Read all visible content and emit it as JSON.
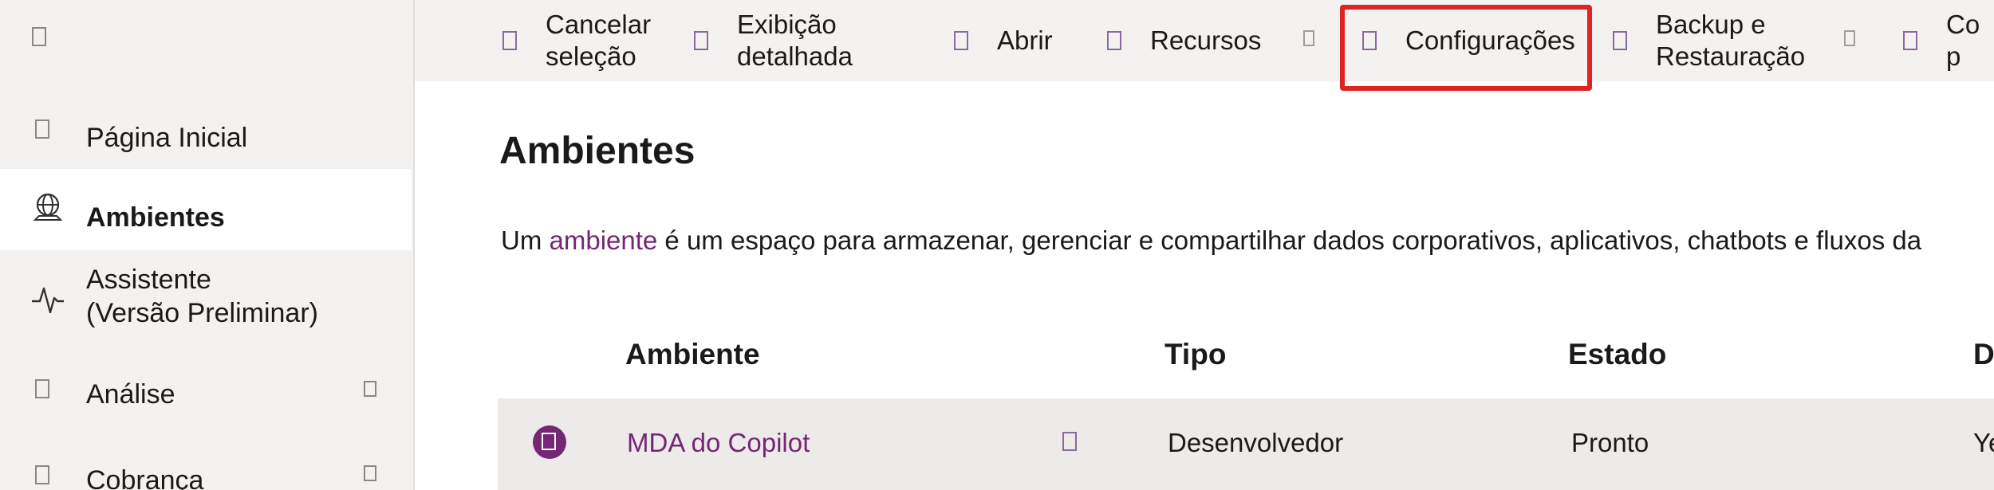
{
  "sidebar": {
    "menu_icon": "hamburger-icon",
    "items": [
      {
        "label": "Página Inicial",
        "icon": "home-icon"
      },
      {
        "label": "Ambientes",
        "icon": "globe-icon",
        "active": true
      },
      {
        "label": "Assistente\n(Versão Preliminar)",
        "icon": "pulse-icon"
      },
      {
        "label": "Análise",
        "icon": "chart-icon",
        "expandable": true
      },
      {
        "label": "Cobrança",
        "icon": "billing-icon",
        "expandable": true
      }
    ]
  },
  "commandbar": {
    "items": [
      {
        "label": "Cancelar\nseleção",
        "icon": "cancel-icon"
      },
      {
        "label": "Exibição\ndetalhada",
        "icon": "details-icon"
      },
      {
        "label": "Abrir",
        "icon": "open-icon"
      },
      {
        "label": "Recursos",
        "icon": "resources-icon"
      },
      {
        "label": "Configurações",
        "icon": "settings-icon",
        "highlighted": true
      },
      {
        "label": "Backup e\nRestauração",
        "icon": "backup-icon"
      },
      {
        "label": "Co p",
        "icon": "copy-icon"
      }
    ]
  },
  "main": {
    "title": "Ambientes",
    "description_prefix": "Um ",
    "description_link": "ambiente",
    "description_suffix": " é um espaço para armazenar, gerenciar e compartilhar dados corporativos, aplicativos, chatbots e fluxos da",
    "table": {
      "headers": [
        "Ambiente",
        "Tipo",
        "Estado",
        "D"
      ],
      "rows": [
        {
          "name": "MDA do Copilot",
          "type": "Desenvolvedor",
          "state": "Pronto",
          "extra": "Ye"
        }
      ]
    }
  },
  "colors": {
    "accent": "#742774",
    "highlight": "#e02424",
    "sidebar_bg": "#f3f2f1",
    "row_selected": "#edebe9"
  }
}
